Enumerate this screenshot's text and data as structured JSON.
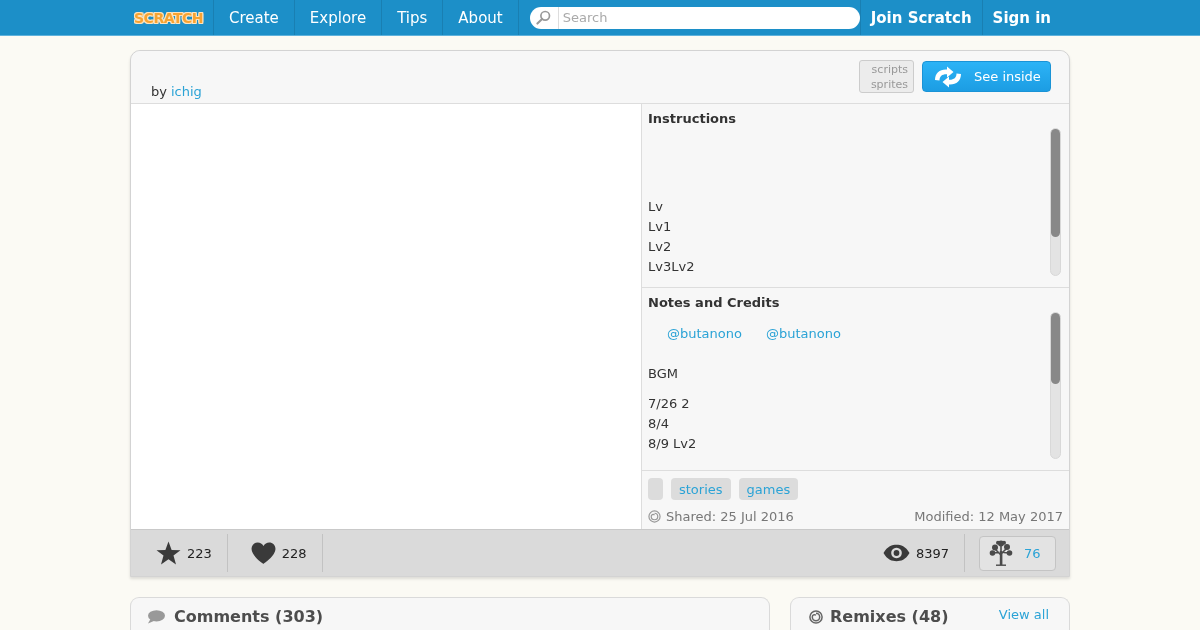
{
  "nav": {
    "logo": "SCRATCH",
    "links": [
      "Create",
      "Explore",
      "Tips",
      "About"
    ],
    "search": {
      "placeholder": "Search"
    },
    "actions": [
      "Join Scratch",
      "Sign in"
    ]
  },
  "project": {
    "by_label": "by",
    "author": "ichig",
    "view_toggle": [
      "scripts",
      "sprites"
    ],
    "see_inside": "See inside"
  },
  "instructions": {
    "title": "Instructions",
    "lines": [
      "Lv",
      "Lv1",
      "Lv2",
      "Lv3Lv2"
    ]
  },
  "notes": {
    "title": "Notes and Credits",
    "paragraphs": [
      [
        {
          "kind": "mentions",
          "links": [
            "@butanono",
            "@butanono"
          ]
        }
      ],
      [
        {
          "kind": "text",
          "text": "BGM"
        }
      ],
      [
        {
          "kind": "text",
          "text": "7/26 2"
        },
        {
          "kind": "text",
          "text": "8/4"
        },
        {
          "kind": "text",
          "text": "8/9 Lv2"
        }
      ]
    ]
  },
  "tags": [
    {
      "kind": "blank"
    },
    {
      "kind": "text",
      "label": "stories"
    },
    {
      "kind": "text",
      "label": "games"
    }
  ],
  "dates": {
    "shared": "Shared: 25 Jul 2016",
    "modified": "Modified: 12 May 2017"
  },
  "stats": {
    "favorites": "223",
    "loves": "228",
    "views": "8397",
    "remixes": "76"
  },
  "comments": {
    "title": "Comments (303)"
  },
  "remixes": {
    "title": "Remixes (48)",
    "view_all": "View all"
  }
}
